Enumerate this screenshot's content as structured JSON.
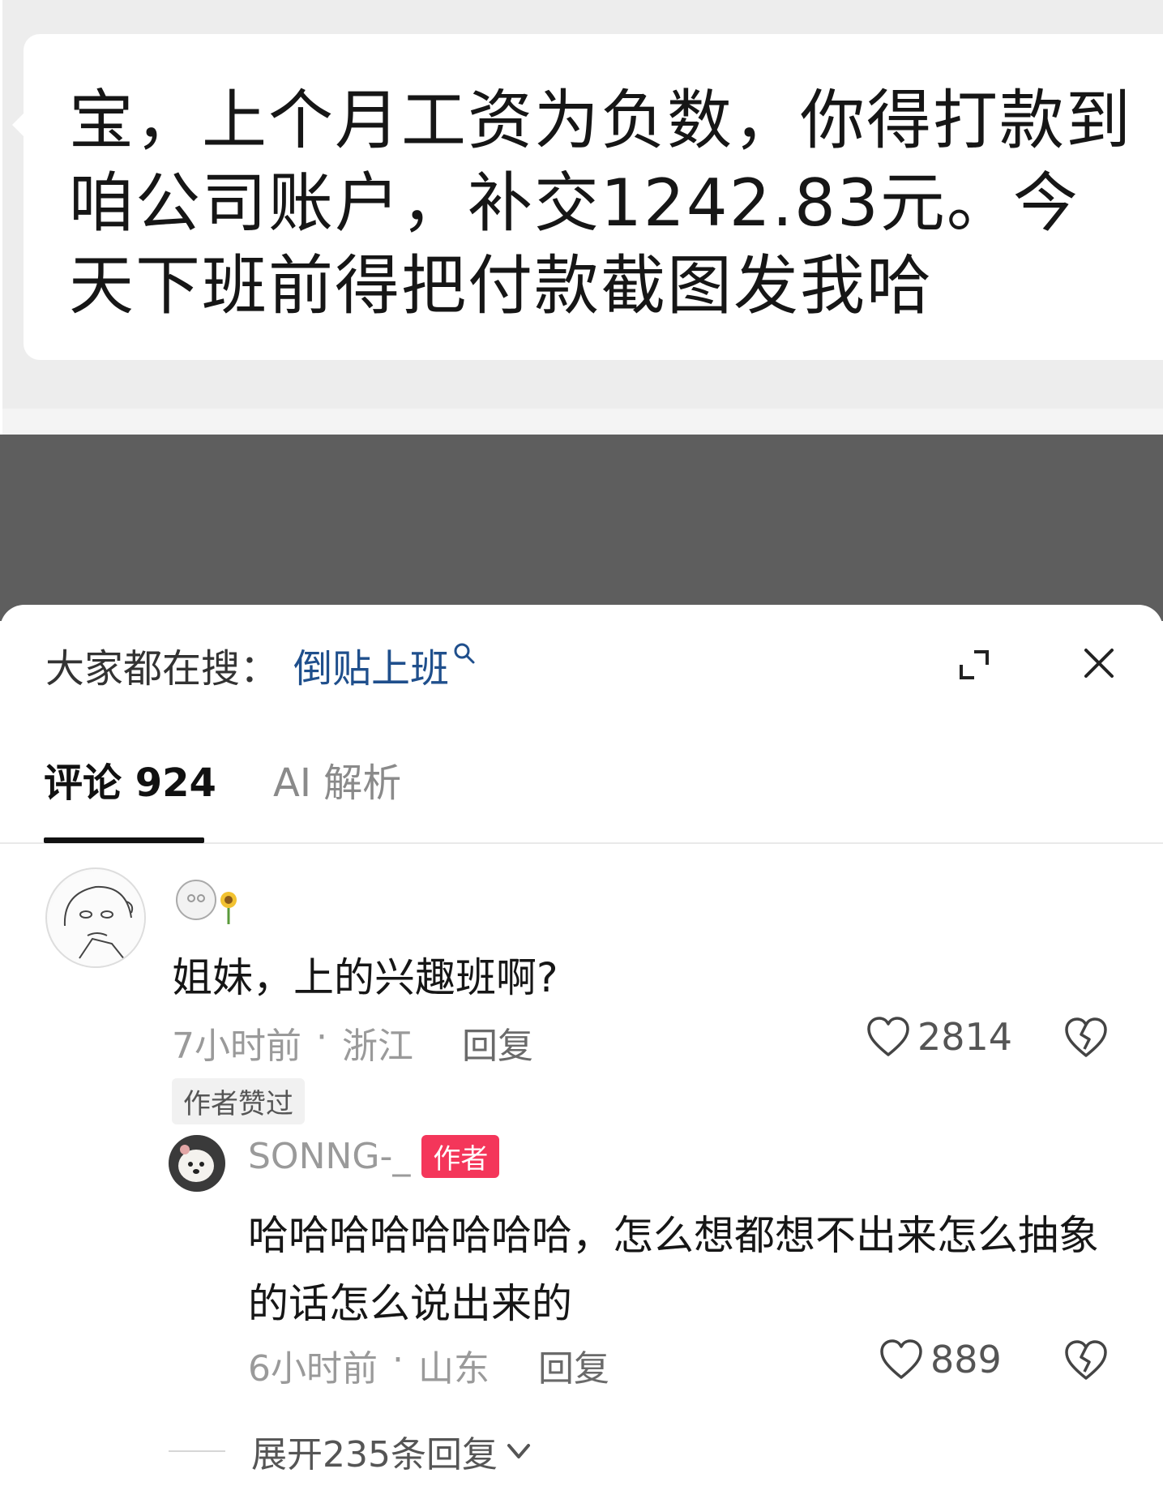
{
  "message": {
    "text": "宝，上个月工资为负数，你得打款到咱公司账户，补交1242.83元。今天下班前得把付款截图发我哈"
  },
  "search": {
    "prefix": "大家都在搜：",
    "term": "倒贴上班"
  },
  "tabs": [
    {
      "label": "评论 924"
    },
    {
      "label": "AI 解析"
    }
  ],
  "comments": [
    {
      "author_icon": "doodle-emoji-name",
      "text": "姐妹，上的兴趣班啊?",
      "time": "7小时前",
      "location": "浙江",
      "reply_label": "回复",
      "likes": "2814",
      "tag": "作者赞过"
    }
  ],
  "reply": {
    "author": "SONNG-_",
    "badge": "作者",
    "text": "哈哈哈哈哈哈哈哈，怎么想都想不出来怎么抽象的话怎么说出来的",
    "time": "6小时前",
    "location": "山东",
    "reply_label": "回复",
    "likes": "889"
  },
  "expand_replies": "展开235条回复",
  "colors": {
    "search_term": "#1f4f8c",
    "author_badge": "#f4365a",
    "overlay": "#5e5e5e"
  }
}
